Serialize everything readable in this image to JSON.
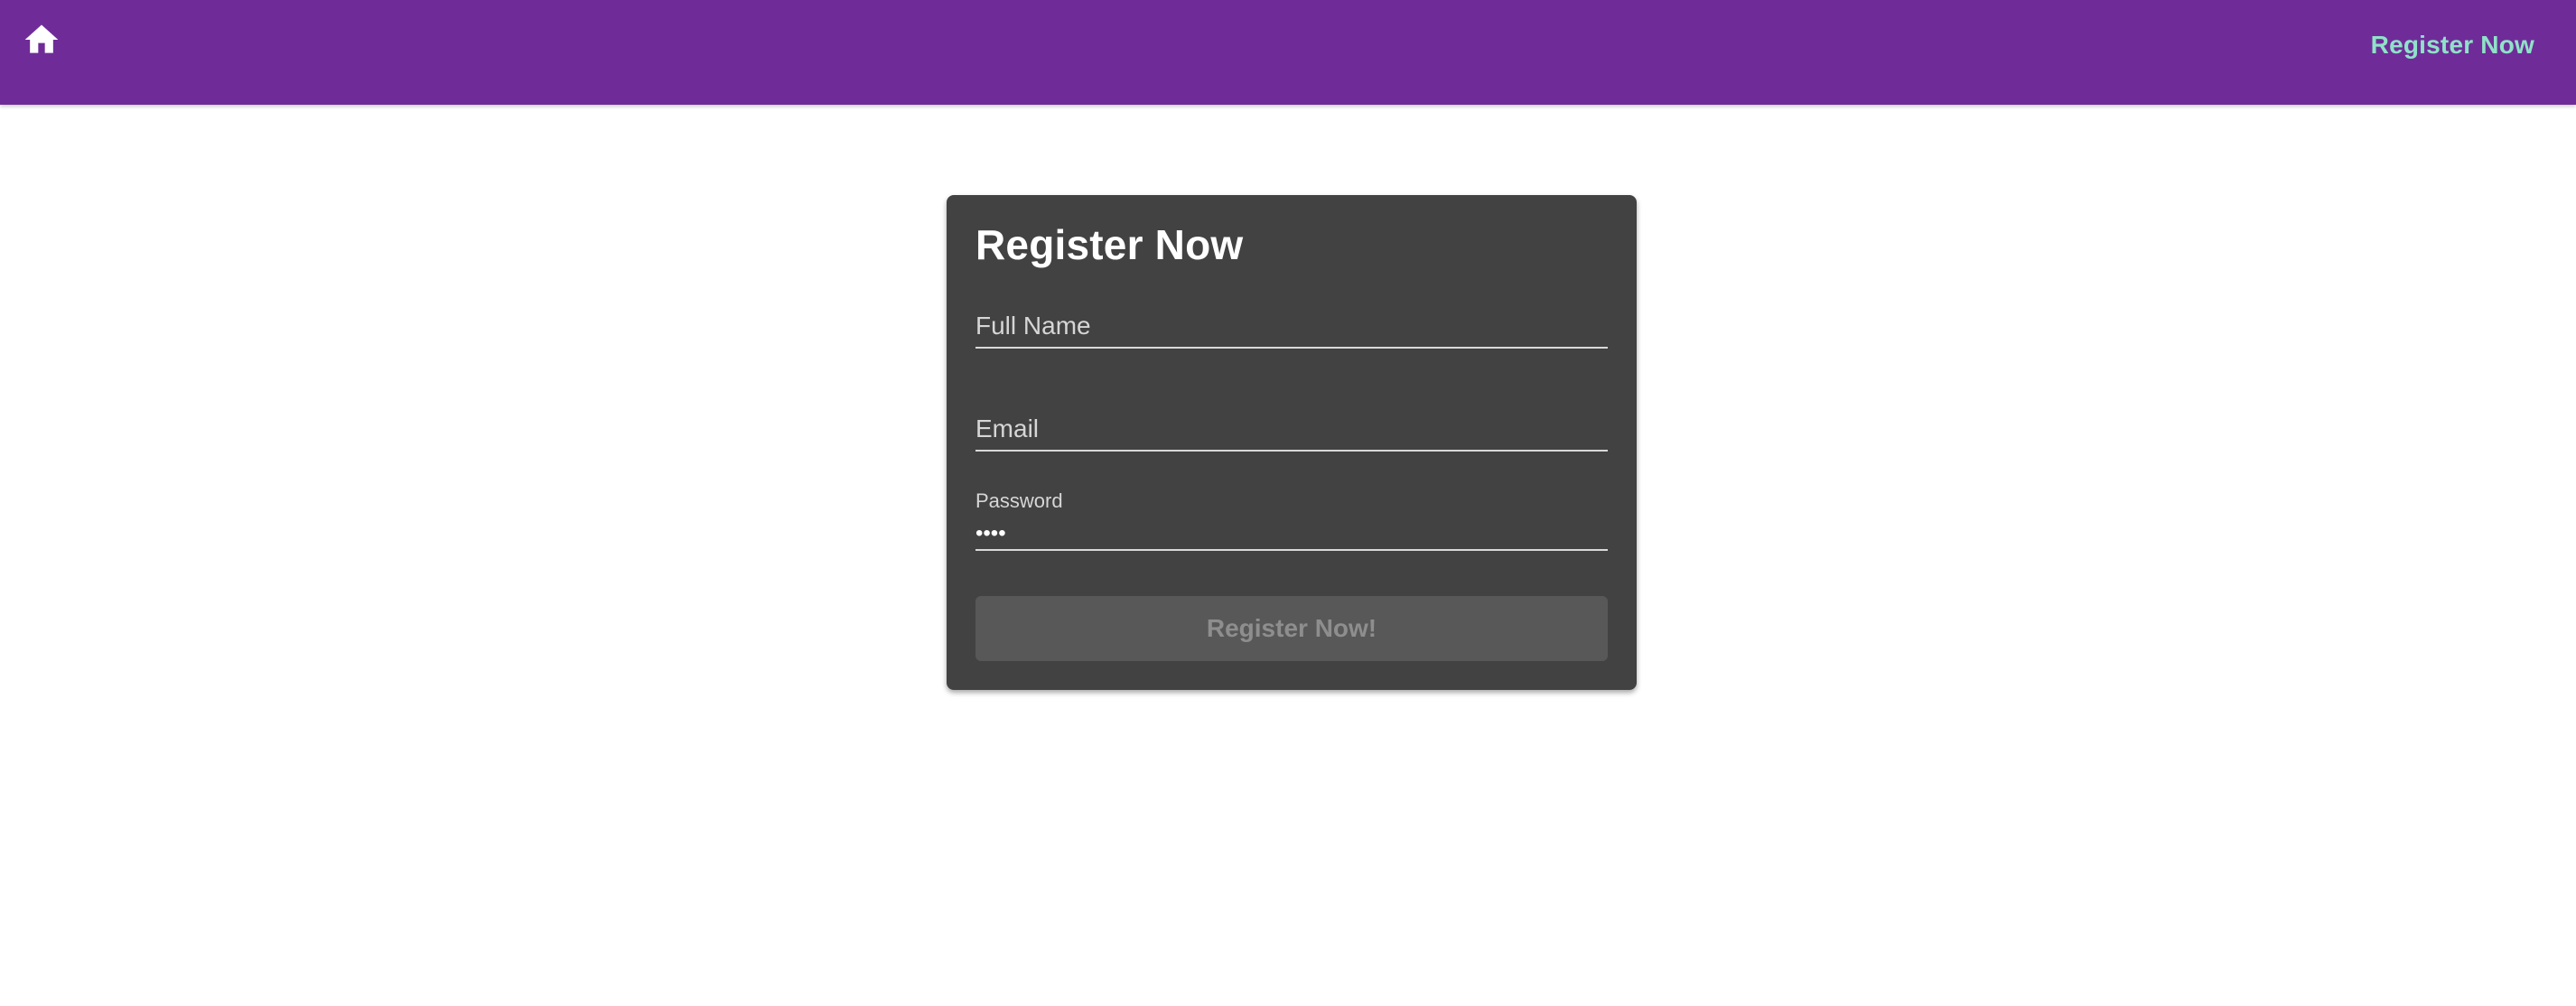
{
  "topbar": {
    "home_icon": "home-icon",
    "register_link": "Register Now",
    "background_color": "#6f2c99",
    "link_color": "#8fe2c8"
  },
  "card": {
    "title": "Register Now",
    "background_color": "#424242",
    "fields": {
      "full_name": {
        "placeholder": "Full Name",
        "value": ""
      },
      "email": {
        "placeholder": "Email",
        "value": ""
      },
      "password": {
        "label": "Password",
        "value": "••••"
      }
    },
    "submit_label": "Register Now!",
    "submit_state": "disabled"
  }
}
